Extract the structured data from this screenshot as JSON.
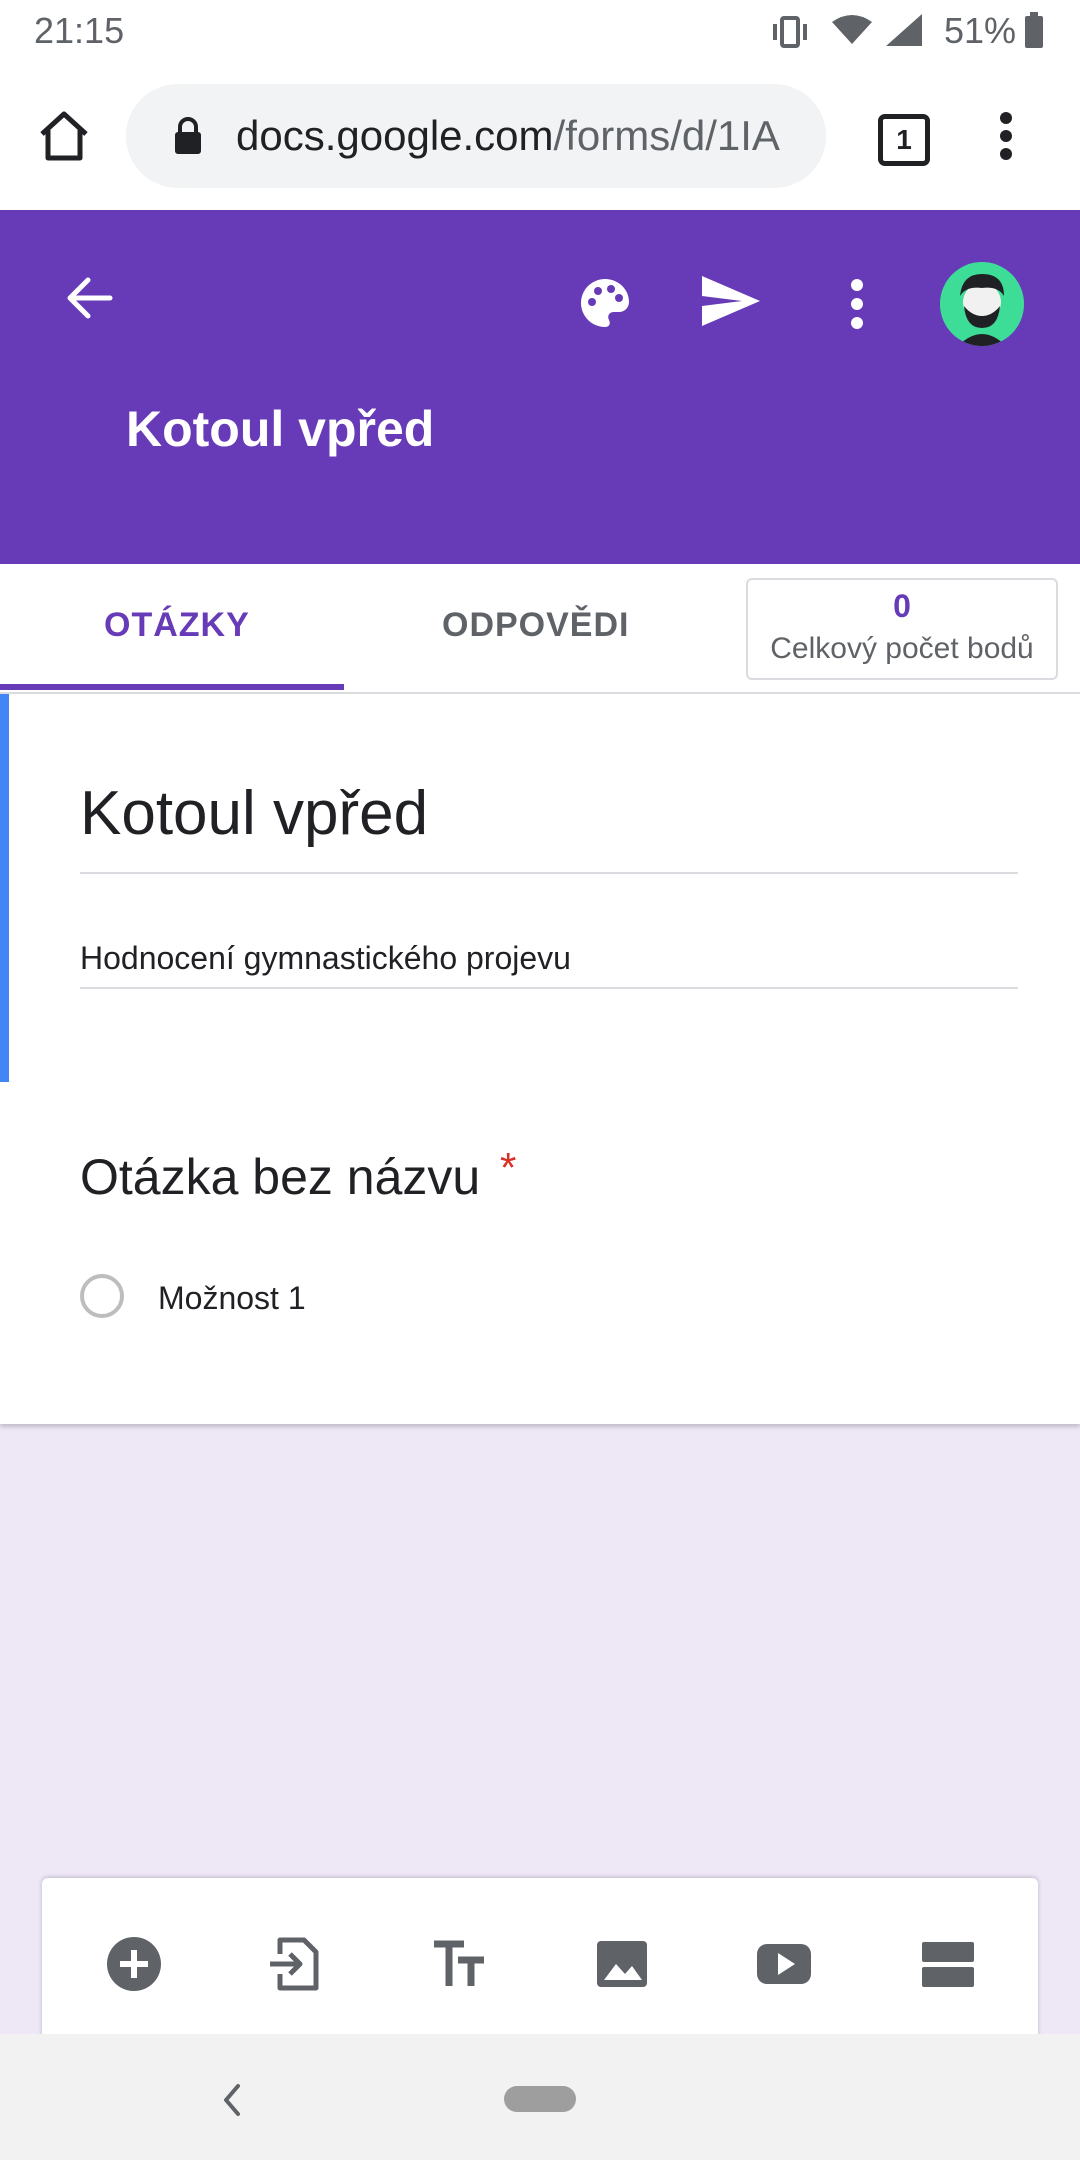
{
  "status_bar": {
    "time": "21:15",
    "battery": "51%"
  },
  "browser": {
    "url_domain": "docs.google.com",
    "url_path": "/forms/d/1IA",
    "tab_count": "1"
  },
  "header": {
    "title": "Kotoul vpřed"
  },
  "tabs": {
    "questions": "OTÁZKY",
    "responses": "ODPOVĚDI"
  },
  "points": {
    "value": "0",
    "label": "Celkový počet bodů"
  },
  "form": {
    "title": "Kotoul vpřed",
    "description": "Hodnocení gymnastického projevu"
  },
  "question": {
    "title": "Otázka bez názvu",
    "required_mark": "*",
    "option_1": "Možnost 1"
  },
  "toolbar": {
    "icons": [
      "add-question-icon",
      "import-questions-icon",
      "title-text-icon",
      "image-icon",
      "video-icon",
      "section-icon"
    ]
  },
  "colors": {
    "accent": "#673ab7",
    "background": "#ede7f6",
    "focus": "#4285f4",
    "required": "#d93025"
  }
}
